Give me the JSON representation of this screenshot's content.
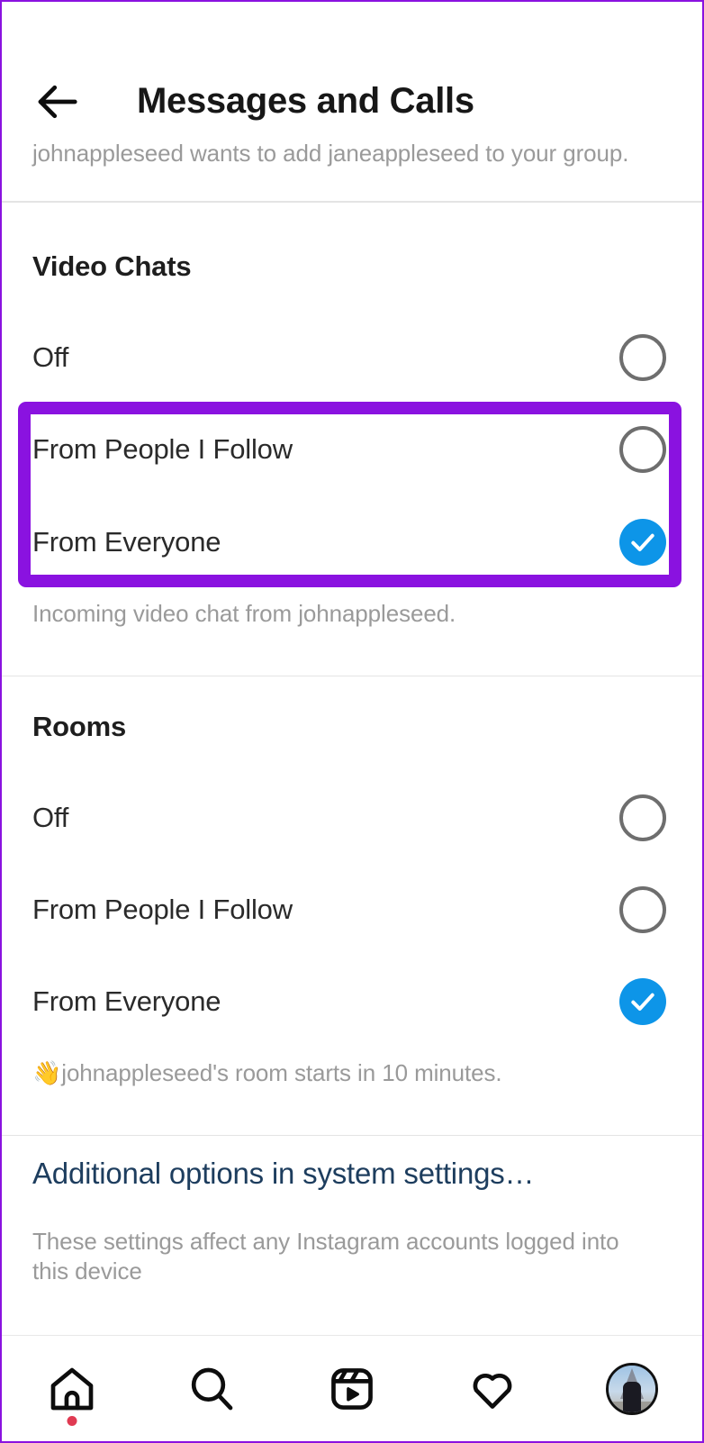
{
  "header": {
    "back_icon": "back-arrow-icon",
    "title": "Messages and Calls"
  },
  "group_notice": {
    "text": "johnappleseed wants to add janeappleseed to your group."
  },
  "video_chats": {
    "heading": "Video Chats",
    "options": [
      {
        "label": "Off",
        "selected": false
      },
      {
        "label": "From People I Follow",
        "selected": false
      },
      {
        "label": "From Everyone",
        "selected": true
      }
    ],
    "caption": "Incoming video chat from johnappleseed."
  },
  "rooms": {
    "heading": "Rooms",
    "options": [
      {
        "label": "Off",
        "selected": false
      },
      {
        "label": "From People I Follow",
        "selected": false
      },
      {
        "label": "From Everyone",
        "selected": true
      }
    ],
    "caption": "👋johnappleseed's room starts in 10 minutes."
  },
  "footer": {
    "link_label": "Additional options in system settings…",
    "note": "These settings affect any Instagram accounts logged into this device"
  },
  "bottom_nav": {
    "items": [
      {
        "icon": "home-icon",
        "badge": true
      },
      {
        "icon": "search-icon",
        "badge": false
      },
      {
        "icon": "reels-icon",
        "badge": false
      },
      {
        "icon": "heart-icon",
        "badge": false
      },
      {
        "icon": "profile-avatar",
        "badge": false
      }
    ]
  },
  "colors": {
    "highlight_purple": "#8a12e0",
    "selected_blue": "#0d95e8",
    "radio_gray": "#6e6e6e",
    "link_navy": "#1d3d5e",
    "caption_gray": "#9a9a9a",
    "badge_red": "#e03a52"
  }
}
